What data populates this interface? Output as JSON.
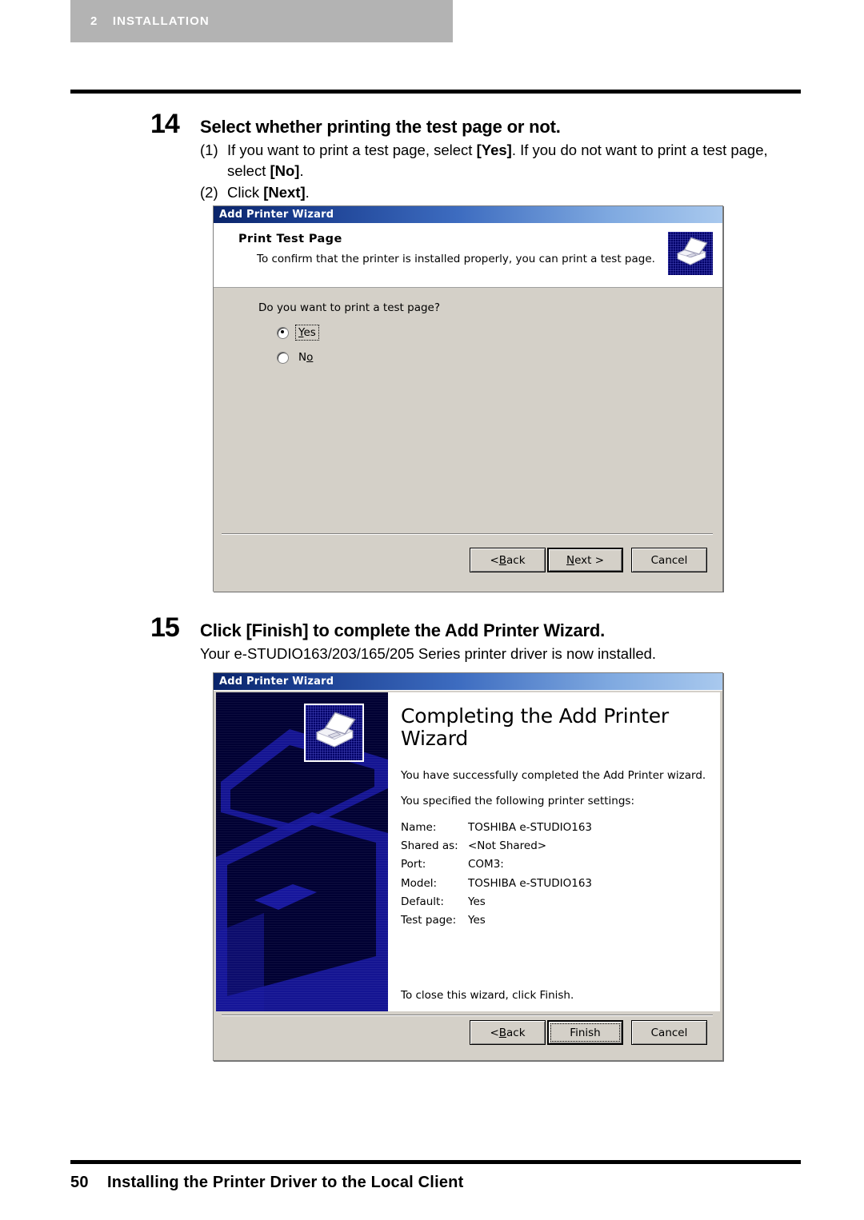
{
  "page": {
    "chapter_number": "2",
    "chapter_title": "INSTALLATION",
    "footer_page_number": "50",
    "footer_title": "Installing the Printer Driver to the Local Client"
  },
  "steps": [
    {
      "number": "14",
      "title": "Select whether printing the test page or not.",
      "substeps": [
        {
          "marker": "(1)",
          "text_1": "If you want to print a test page, select ",
          "bold_1": "[Yes]",
          "text_2": ". If you do not want to print a test page, select ",
          "bold_2": "[No]",
          "text_3": "."
        },
        {
          "marker": "(2)",
          "text_1": "Click ",
          "bold_1": "[Next]",
          "text_2": "."
        }
      ]
    },
    {
      "number": "15",
      "title": "Click [Finish] to complete the Add Printer Wizard.",
      "description": "Your e-STUDIO163/203/165/205 Series printer driver is now installed."
    }
  ],
  "dialog_test_page": {
    "title": "Add Printer Wizard",
    "header_title": "Print Test Page",
    "header_subtitle": "To confirm that the printer is installed properly, you can print a test page.",
    "icon": "printer-icon",
    "question": "Do you want to print a test page?",
    "options": [
      {
        "label_prefix": "",
        "label_underlined": "Y",
        "label_suffix": "es",
        "checked": true,
        "focused": true
      },
      {
        "label_prefix": "N",
        "label_underlined": "o",
        "label_suffix": "",
        "checked": false,
        "focused": false
      }
    ],
    "buttons": [
      {
        "prefix": "< ",
        "underlined": "B",
        "suffix": "ack",
        "default": false,
        "focused": false
      },
      {
        "prefix": "",
        "underlined": "N",
        "suffix": "ext >",
        "default": true,
        "focused": false
      },
      {
        "prefix": "Cancel",
        "underlined": "",
        "suffix": "",
        "default": false,
        "focused": false
      }
    ]
  },
  "dialog_completing": {
    "title": "Add Printer Wizard",
    "welcome_title": "Completing the Add Printer Wizard",
    "icon": "printer-icon",
    "paragraph_1": "You have successfully completed the Add Printer wizard.",
    "paragraph_2": "You specified the following printer settings:",
    "settings": [
      {
        "key": "Name:",
        "value": "TOSHIBA e-STUDIO163"
      },
      {
        "key": "Shared as:",
        "value": "<Not Shared>"
      },
      {
        "key": "Port:",
        "value": "COM3:"
      },
      {
        "key": "Model:",
        "value": "TOSHIBA e-STUDIO163"
      },
      {
        "key": "Default:",
        "value": "Yes"
      },
      {
        "key": "Test page:",
        "value": "Yes"
      }
    ],
    "closing_text": "To close this wizard, click Finish.",
    "buttons": [
      {
        "prefix": "< ",
        "underlined": "B",
        "suffix": "ack",
        "default": false,
        "focused": false
      },
      {
        "prefix": "Finish",
        "underlined": "",
        "suffix": "",
        "default": true,
        "focused": true
      },
      {
        "prefix": "Cancel",
        "underlined": "",
        "suffix": "",
        "default": false,
        "focused": false
      }
    ]
  },
  "colors": {
    "band": "#b3b3b3",
    "dialog_face": "#d4d0c8",
    "titlebar_start": "#0a246a",
    "titlebar_end": "#a9c9ee",
    "welcome_bg": "#000033",
    "welcome_art": "#1a1aa8"
  }
}
